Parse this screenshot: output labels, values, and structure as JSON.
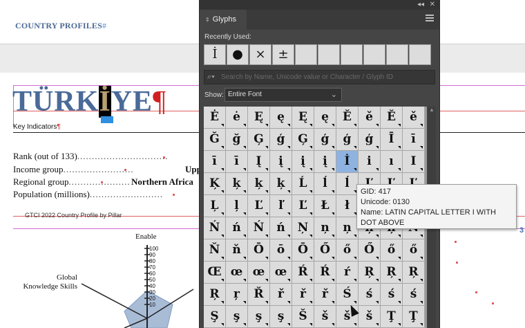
{
  "document": {
    "header_title": "COUNTRY PROFILES",
    "header_mark": "#",
    "country_title_pre": "TÜRK",
    "country_title_hl": "İ",
    "country_title_post": "YE",
    "pilcrow": "¶",
    "key_indicators": "Key Indicators",
    "rows": [
      {
        "label": "Rank (out of 133)",
        "dots": "...............................",
        "value": ""
      },
      {
        "label": "Income group",
        "dots": "........................",
        "value": "Upp"
      },
      {
        "label": "Regional group",
        "dots": ".....................",
        "value": "Northern Africa"
      },
      {
        "label": "Population (millions)",
        "dots": ".........................",
        "value": ""
      }
    ],
    "footer": "GTCI 2022 Country Profile by Pillar",
    "chart_label_top": "Enable",
    "chart_label_left": "Global Knowledge Skills",
    "chart_ticks": [
      "100",
      "90",
      "80",
      "70",
      "60",
      "50",
      "40",
      "30",
      "20",
      "10"
    ],
    "side_number": "3"
  },
  "panel": {
    "tab_title": "Glyphs",
    "recent_label": "Recently Used:",
    "recent": [
      "İ",
      "●",
      "×",
      "±",
      "",
      "",
      "",
      "",
      "",
      ""
    ],
    "search_placeholder": "Search by Name, Unicode value or Character / Glyph ID",
    "show_label": "Show:",
    "show_value": "Entire Font",
    "glyphs": [
      "Ė",
      "ė",
      "Ę",
      "ę",
      "Ę",
      "ę",
      "Ě",
      "ě",
      "Ě",
      "ě",
      "Ğ",
      "ğ",
      "Ģ",
      "ģ",
      "Ģ",
      "ģ",
      "ģ",
      "ģ",
      "Ī",
      "ī",
      "ī",
      "ī",
      "Į",
      "į",
      "į",
      "į",
      "İ",
      "i",
      "ı",
      "I",
      "Ķ",
      "ķ",
      "ķ",
      "ķ",
      "Ĺ",
      "ĺ",
      "ĺ",
      "Ľ",
      "Ľ",
      "Ľ",
      "Ļ",
      "ļ",
      "Ľ",
      "ľ",
      "Ľ",
      "Ł",
      "ł",
      "Ł",
      "ł",
      "Ń",
      "Ń",
      "ń",
      "Ń",
      "ń",
      "Ņ",
      "ņ",
      "ņ",
      "ņ",
      "ņ",
      "Ň",
      "Ň",
      "ň",
      "Ō",
      "ō",
      "Ō",
      "Ő",
      "ő",
      "Ő",
      "ő",
      "ő",
      "Œ",
      "œ",
      "œ",
      "œ",
      "Ŕ",
      "Ŕ",
      "ŕ",
      "Ŗ",
      "Ŗ",
      "Ŗ",
      "Ŗ",
      "ŗ",
      "Ř",
      "ř",
      "ř",
      "ř",
      "Ś",
      "ś",
      "ś",
      "ś",
      "Ş",
      "ş",
      "ş",
      "ş",
      "Š",
      "š",
      "š",
      "š",
      "Ţ",
      "Ţ"
    ],
    "selected_index": 26,
    "tooltip": {
      "gid": "GID: 417",
      "unicode": "Unicode: 0130",
      "name": "Name: LATIN CAPITAL LETTER I WITH DOT ABOVE"
    }
  },
  "colors": {
    "panel_bg": "#454545",
    "glyph_cell_bg": "#dcdcdc",
    "selected_cell": "#8fb3e0",
    "title_blue": "#4a6a98"
  }
}
